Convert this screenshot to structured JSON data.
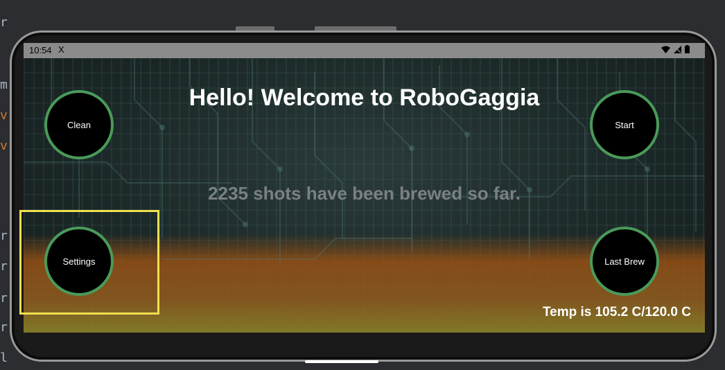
{
  "status_bar": {
    "time": "10:54",
    "extra": "X"
  },
  "app": {
    "title": "Hello! Welcome to RoboGaggia",
    "shots_text": "2235 shots have been brewed so far.",
    "temp_text": "Temp is 105.2 C/120.0 C",
    "buttons": {
      "clean": "Clean",
      "start": "Start",
      "settings": "Settings",
      "last_brew": "Last Brew"
    }
  },
  "gutter": {
    "glyphs": [
      "r",
      "m",
      "v",
      "v",
      "r",
      "r",
      "r",
      "r",
      "l"
    ]
  },
  "colors": {
    "button_border": "#4a9a5a",
    "highlight": "#f0e050"
  }
}
